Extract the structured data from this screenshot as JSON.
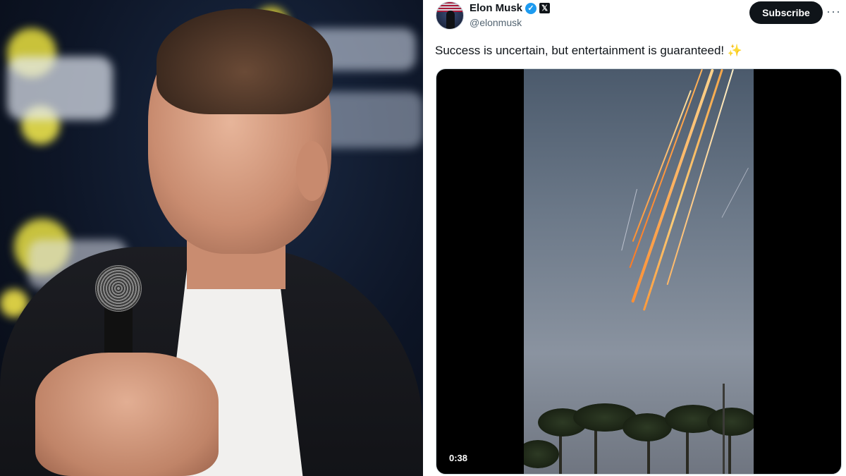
{
  "photo": {
    "icon": "person-with-microphone",
    "colors": {
      "background": "#0d1526",
      "jacket": "#1c1d22",
      "shirt": "#f1f0ee"
    }
  },
  "tweet": {
    "display_name": "Elon Musk",
    "handle": "@elonmusk",
    "verified_icon": "verified-badge-icon",
    "affiliation_icon": "x-logo-icon",
    "subscribe_label": "Subscribe",
    "more_icon": "more-options-icon",
    "text": "Success is uncertain, but entertainment is guaranteed!",
    "emoji": "✨",
    "media": {
      "type": "video",
      "duration": "0:38"
    },
    "colors": {
      "accent": "#1d9bf0",
      "text": "#0f1419",
      "secondary": "#536471",
      "button": "#0f1419"
    }
  }
}
